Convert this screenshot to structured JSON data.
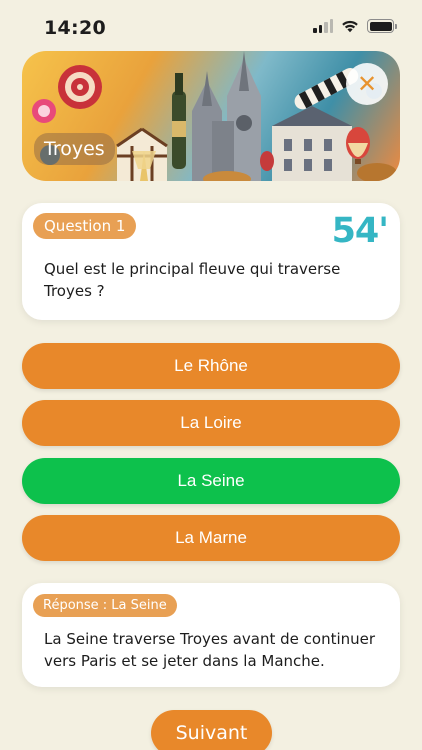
{
  "status_bar": {
    "time": "14:20",
    "icons": [
      "signal-icon",
      "wifi-icon",
      "battery-icon"
    ]
  },
  "hero": {
    "city": "Troyes",
    "close_icon": "close-icon"
  },
  "question": {
    "label": "Question 1",
    "timer": "54'",
    "text": "Quel est le principal fleuve qui traverse Troyes ?"
  },
  "answers": [
    {
      "label": "Le Rhône",
      "state": "default"
    },
    {
      "label": "La Loire",
      "state": "default"
    },
    {
      "label": "La Seine",
      "state": "correct"
    },
    {
      "label": "La Marne",
      "state": "default"
    }
  ],
  "explanation": {
    "badge": "Réponse : La Seine",
    "text": "La Seine traverse Troyes avant de continuer vers Paris et se jeter dans la Manche."
  },
  "next_button": {
    "label": "Suivant"
  },
  "colors": {
    "background": "#f3f0e1",
    "accent": "#e8882a",
    "correct": "#0dc14c",
    "timer": "#35b6c4",
    "pill": "#e8a054"
  }
}
